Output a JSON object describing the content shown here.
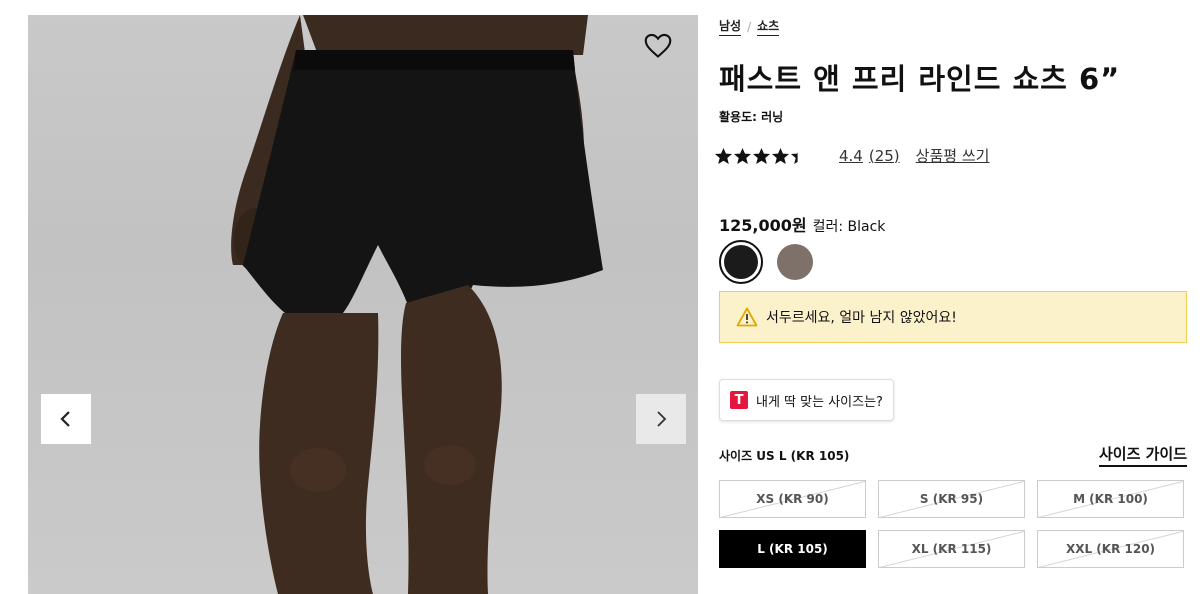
{
  "breadcrumb": {
    "items": [
      "남성",
      "쇼츠"
    ],
    "separator": "/"
  },
  "product": {
    "title": "패스트 앤 프리 라인드 쇼츠 6”",
    "activity": "활용도: 러닝",
    "rating": {
      "score": "4.4",
      "count": "(25)",
      "stars_filled": 4.4,
      "write_review": "상품평 쓰기"
    },
    "price": "125,000원",
    "color_label": "컬러: Black",
    "swatches": [
      {
        "name": "Black",
        "color": "#1b1b1b",
        "selected": true
      },
      {
        "name": "Taupe",
        "color": "#7d7169",
        "selected": false
      }
    ]
  },
  "alert": {
    "text": "서두르세요, 얼마 남지 않았어요!",
    "icon": "warning-icon"
  },
  "fit_finder": {
    "label": "내게 딱 맞는 사이즈는?",
    "logo_text": "T"
  },
  "size": {
    "label": "사이즈 US L (KR 105)",
    "guide": "사이즈 가이드",
    "options": [
      {
        "label": "XS (KR 90)",
        "state": "unavailable"
      },
      {
        "label": "S (KR 95)",
        "state": "unavailable"
      },
      {
        "label": "M (KR 100)",
        "state": "unavailable"
      },
      {
        "label": "L (KR 105)",
        "state": "selected"
      },
      {
        "label": "XL (KR 115)",
        "state": "unavailable"
      },
      {
        "label": "XXL (KR 120)",
        "state": "unavailable"
      }
    ]
  },
  "gallery": {
    "prev_icon": "chevron-left-icon",
    "next_icon": "chevron-right-icon",
    "wishlist_icon": "heart-icon"
  },
  "colors": {
    "accent_black": "#000000",
    "alert_bg": "#fbf2cc",
    "alert_border": "#f1cf55",
    "brand_red": "#e4163e"
  }
}
